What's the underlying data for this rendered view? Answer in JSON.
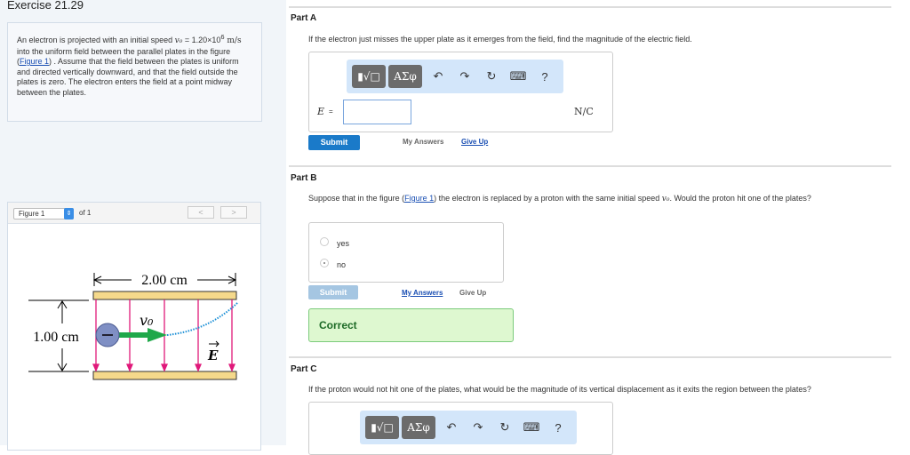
{
  "exercise": {
    "title": "Exercise 21.29"
  },
  "problem": {
    "t1": "An electron is projected with an initial speed ",
    "v0": "v₀",
    "t2": " = 1.20×10",
    "exp": "6",
    "unit": " m/s",
    "t3": " into the uniform field between the parallel plates in the figure (",
    "link": "Figure 1",
    "t4": ") . Assume that the field between the plates is uniform and directed vertically downward, and that the field outside the plates is zero. The electron enters the field at a point midway between the plates."
  },
  "figure": {
    "select": "Figure 1",
    "of": "of 1",
    "prev": "<",
    "next": ">",
    "width_label": "2.00 cm",
    "height_label": "1.00 cm",
    "v_label": "v₀",
    "e_label": "E",
    "colors": {
      "plate": "#f5d98b",
      "field": "#e0197a",
      "arrow": "#1fa84a",
      "path": "#1a8fd6"
    }
  },
  "partA": {
    "label": "Part A",
    "question": "If the electron just misses the upper plate as it emerges from the field, find the magnitude of the electric field.",
    "var": "E",
    "eq": "=",
    "unit": "N/C",
    "value": "",
    "submit": "Submit",
    "my_answers": "My Answers",
    "give_up": "Give Up"
  },
  "toolbar": {
    "templates": "▮√□",
    "symbols": "ΑΣφ",
    "undo": "↶",
    "redo": "↷",
    "reset": "↻",
    "keyboard": "⌨",
    "help": "?"
  },
  "partB": {
    "label": "Part B",
    "q1": "Suppose that in the figure (",
    "link": "Figure 1",
    "q2": ") the electron is replaced by a proton with the same initial speed ",
    "v0": "v₀",
    "q3": ". Would the proton hit one of the plates?",
    "options": [
      "yes",
      "no"
    ],
    "selected": "no",
    "submit": "Submit",
    "my_answers": "My Answers",
    "give_up": "Give Up",
    "result": "Correct"
  },
  "partC": {
    "label": "Part C",
    "question": "If the proton would not hit one of the plates, what would be the magnitude of its vertical displacement as it exits the region between the plates?"
  }
}
